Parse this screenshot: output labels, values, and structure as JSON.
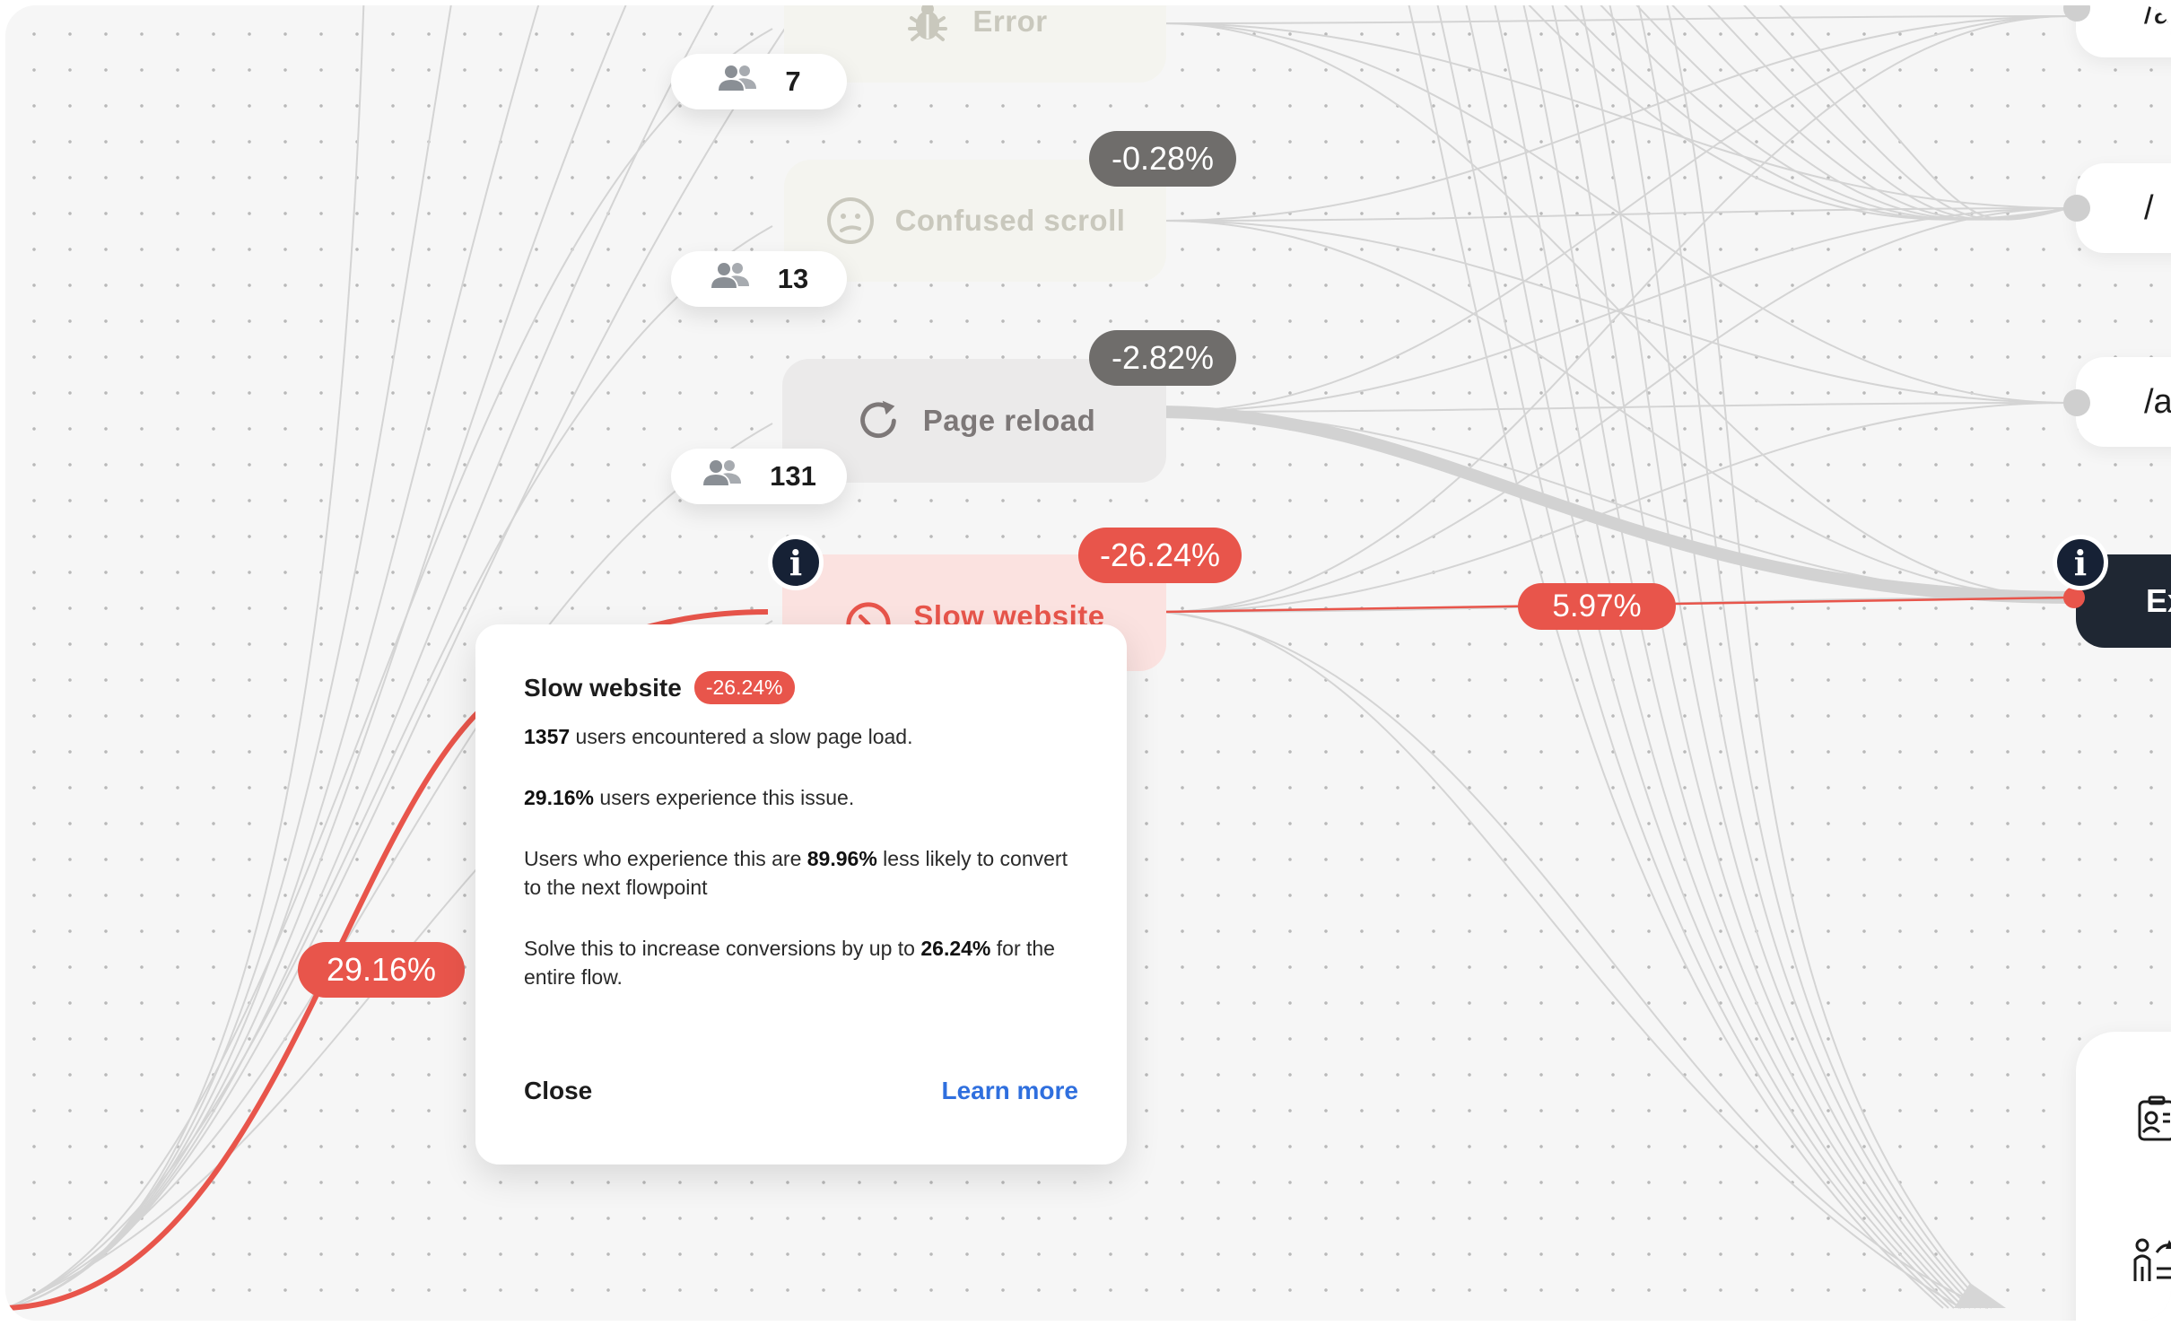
{
  "nodes": {
    "error": {
      "label": "Error",
      "icon": "bug-icon",
      "users": "7"
    },
    "confused_scroll": {
      "label": "Confused scroll",
      "icon": "confused-face-icon",
      "users": "13",
      "delta": "-0.28%"
    },
    "page_reload": {
      "label": "Page reload",
      "icon": "reload-icon",
      "users": "131",
      "delta": "-2.82%"
    },
    "slow_website": {
      "label": "Slow website",
      "icon": "clock-icon",
      "delta": "-26.24%"
    }
  },
  "flow_labels": {
    "entry_share": "29.16%",
    "exit_share": "5.97%"
  },
  "pages": [
    {
      "label": "/a"
    },
    {
      "label": "/"
    },
    {
      "label": "/a"
    }
  ],
  "exit_node": {
    "label": "Ex"
  },
  "popup": {
    "title": "Slow website",
    "badge": "-26.24%",
    "p1_bold": "1357",
    "p1_text": " users encountered a slow page load.",
    "p2_bold": "29.16%",
    "p2_text": " users experience this issue.",
    "p3_pre": "Users who experience this are ",
    "p3_bold": "89.96%",
    "p3_post": " less likely to convert to the next flowpoint",
    "p4_pre": "Solve this to increase conversions by up to ",
    "p4_bold": "26.24%",
    "p4_post": " for the entire flow.",
    "close_label": "Close",
    "learn_more_label": "Learn more"
  },
  "colors": {
    "accent_red": "#e8554b",
    "dark_navy": "#162135",
    "link_blue": "#2f6fde",
    "flow_gray": "#d2d2d2"
  }
}
